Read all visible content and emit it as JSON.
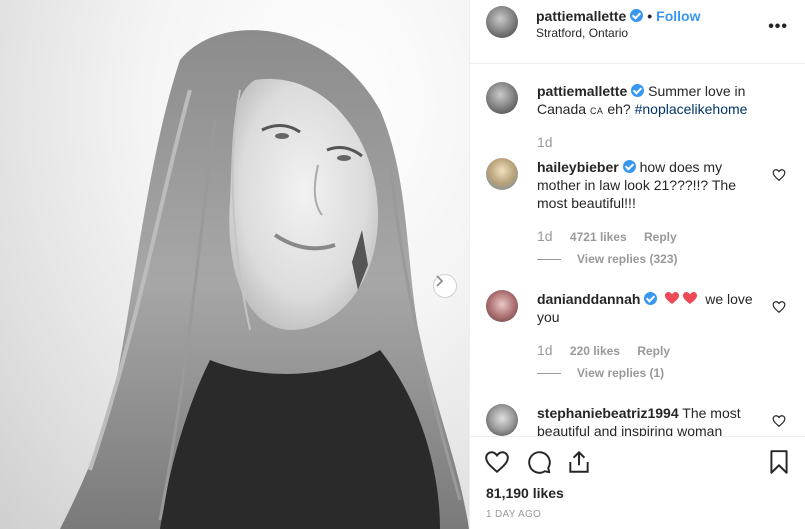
{
  "post": {
    "username": "pattiemallette",
    "follow_label": "Follow",
    "separator": "•",
    "location": "Stratford, Ontario",
    "more_icon": "more-horizontal-icon",
    "caption": {
      "username": "pattiemallette",
      "text_before": "Summer love in Canada",
      "flag": "ca",
      "text_after": " eh?",
      "hashtag": "#noplacelikehome",
      "age": "1d"
    },
    "likes": "81,190 likes",
    "time_ago": "1 DAY AGO"
  },
  "comments": [
    {
      "username": "haileybieber",
      "verified": true,
      "text": "how does my mother in law look 21???!!? The most beautiful!!!",
      "age": "1d",
      "likes": "4721 likes",
      "reply_label": "Reply",
      "view_replies": "View replies (323)"
    },
    {
      "username": "danianddannah",
      "verified": true,
      "text": "we love you",
      "age": "1d",
      "likes": "220 likes",
      "reply_label": "Reply",
      "view_replies": "View replies (1)"
    },
    {
      "username": "stephaniebeatriz1994",
      "verified": false,
      "text": "The most beautiful and inspiring woman"
    }
  ],
  "colors": {
    "accent": "#3897f0",
    "text": "#262626",
    "muted": "#999999",
    "hashtag": "#003569",
    "heart_red": "#ed4956"
  },
  "icons": [
    "heart-icon",
    "comment-icon",
    "share-icon",
    "bookmark-icon",
    "chevron-right-icon",
    "verified-icon"
  ]
}
